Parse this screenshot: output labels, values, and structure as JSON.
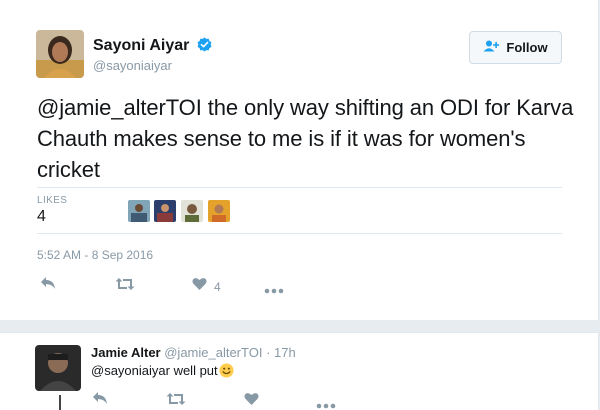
{
  "tweet": {
    "author_name": "Sayoni Aiyar",
    "author_handle": "@sayoniaiyar",
    "follow_label": "Follow",
    "text": "@jamie_alterTOI the only way shifting an ODI for Karva Chauth makes sense to me is if it was for women's cricket",
    "likes_label": "LIKES",
    "likes_count": "4",
    "timestamp": "5:52 AM - 8 Sep 2016",
    "actions": {
      "reply_icon": "reply-icon",
      "retweet_icon": "retweet-icon",
      "like_icon": "heart-icon",
      "like_count": "4",
      "more_icon": "more-icon"
    }
  },
  "reply": {
    "author_name": "Jamie Alter",
    "author_handle": "@jamie_alterTOI",
    "separator": "·",
    "time": "17h",
    "text": "@sayoniaiyar well put",
    "emoji": "smiley-emoji"
  },
  "colors": {
    "background": "#e6ecf0",
    "card": "#ffffff",
    "verified": "#1da1f2",
    "follow_icon": "#1da1f2",
    "muted": "#8899a6",
    "text": "#14171a"
  }
}
